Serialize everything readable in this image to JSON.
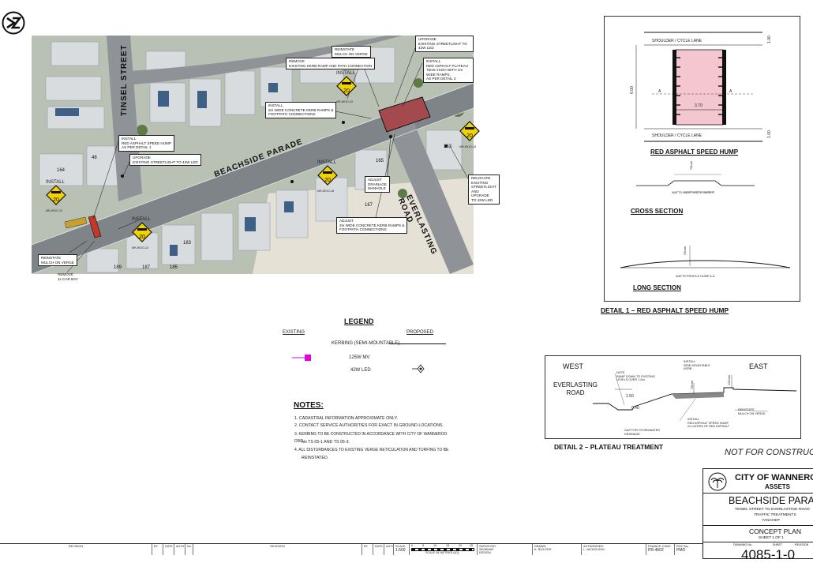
{
  "logo": {
    "icon": "kz-logo-icon"
  },
  "aerial": {
    "streets": {
      "tinsel": "TINSEL STREET",
      "beachside": "BEACHSIDE PARADE",
      "everlasting": "EVERLASTING ROAD"
    },
    "plots": [
      "164",
      "48",
      "163",
      "165",
      "167",
      "183",
      "189",
      "187",
      "185"
    ],
    "callouts": {
      "reinstate_top": "REINSTATE\nMULCH ON VERGE",
      "upgrade_top": "UPGRADE\nEXISTING STREETLIGHT TO 42W LED",
      "install_plateau": "INSTALL\nRED ASPHALT PLATEAU\n75mm HIGH WITH 1m WIDE RAMPS,\nAS PER DETAIL 2",
      "remove_kerb": "REMOVE\nEXISTING KERB RAMP AND PATH CONNECTION",
      "install_ramps_top": "INSTALL\n2m WIDE CONCRETE KERB RAMPS &\nFOOTPATH CONNECTIONS",
      "install_hump": "INSTALL\nRED ASPHALT SPEED HUMP\nAS PER DETAIL 1",
      "upgrade_left": "UPGRADE\nEXISTING STREETLIGHT TO 42W LED",
      "relocate": "RELOCATE\nEXISTING STREETLIGHT AND UPGRADE\nTO 42W LED",
      "adjust_manhole": "ADJUST\nDRAINAGE\nMANHOLE",
      "adjust_ramps": "ADJUST\n2m WIDE CONCRETE KERB RAMPS &\nFOOTPATH CONNECTIONS",
      "reinstate_bottom": "REINSTATE\nMULCH ON VERGE",
      "remove_bay": "REMOVE\n1x CAR BAY"
    },
    "signs": {
      "install": "INSTALL",
      "value": "20",
      "code": "MR-WOO-10",
      "code2": "MR-WOO-18"
    }
  },
  "detail1": {
    "shoulder_top": "SHOULDER / CYCLE LANE",
    "shoulder_bottom": "SHOULDER / CYCLE LANE",
    "width_dim": "6.00",
    "inner_dim": "3.70",
    "edge_dim": "1.00",
    "section_a": "A",
    "title_hump": "RED ASPHALT SPEED HUMP",
    "cross_section": "CROSS SECTION",
    "watts_hump": "WATTS HUMP WIDTH VARIES",
    "height_75": "75mm",
    "watts_profile": "WATTS PROFILE HUMP A-A",
    "long_section": "LONG SECTION",
    "caption": "DETAIL 1 – RED ASPHALT SPEED HUMP"
  },
  "detail2": {
    "west": "WEST",
    "east": "EAST",
    "road": "EVERLASTING\nROAD",
    "note": "NOTE\nRAMP DOWN TO EXISTING\nLEVELS OVER 1.0m.",
    "install_kerb": "INSTALL\nSEMI-MOUNTABLE\nKERB",
    "dim_150": "1.50",
    "dim_040": "0.40",
    "dim_75": "75mm",
    "dim_125": "125mm",
    "reinstate": "REINSTATE\nMULCH ON VERGE",
    "install_hump": "INSTALL\nRED ASPHALT SPEED HUMP\n2x LAYERS OF RED ASPHALT",
    "gap": "GAP FOR STORMWATER\nDRAINAGE",
    "caption": "DETAIL 2 – PLATEAU TREATMENT"
  },
  "legend": {
    "title": "LEGEND",
    "existing": "EXISTING",
    "proposed": "PROPOSED",
    "items": [
      "KERBING (SEMI-MOUNTABLE)",
      "125W MV",
      "42W LED"
    ],
    "colors": {
      "existing_light": "#e600e6"
    }
  },
  "notes": {
    "title": "NOTES:",
    "items": [
      "1.  CADASTRAL INFORMATION APPROXIMATE ONLY.",
      "2.  CONTACT SERVICE AUTHORITIES FOR EXACT IN GROUND LOCATIONS.",
      "3.  KERBING TO BE CONSTRUCTED IN ACCORDANCE WITH CITY OF WANNEROO DRG.",
      "No TS 05-1 AND TS 05-3.",
      "4.  ALL DISTURBANCES TO EXISTING VERGE RETICULATION AND TURFING TO BE",
      "REINSTATED."
    ]
  },
  "stamp": "NOT FOR CONSTRUCTION",
  "title_block": {
    "org": "CITY OF WANNEROO",
    "dept": "ASSETS",
    "project": "BEACHSIDE PARADE",
    "sub1": "TINSEL STREET TO EVERLASTING ROAD",
    "sub2": "TRAFFIC TREATMENTS",
    "sub3": "YANCHEP",
    "plan": "CONCEPT PLAN",
    "sheet": "SHEET 1 OF 1",
    "drawing_no_label": "DRAWING No.",
    "sheet_label": "SHEET",
    "revision_label": "REVISION",
    "drawing_no": "4085-1-0"
  },
  "strip": {
    "revision": "REVISION",
    "by": "BY",
    "date": "DATE",
    "auth": "AUTH",
    "no": "No.",
    "scale_label": "SCALE:",
    "scale": "1:500",
    "scale_ticks": [
      "0",
      "5",
      "10",
      "15",
      "20",
      "25"
    ],
    "scale_caption": "SCALE IN METRES (A1)",
    "surveyed": "SURVEYED:",
    "surveyor": "SEARMAP",
    "designed": "DESIGN",
    "drawn": "DRAWN:",
    "drawer": "K. RICHTER",
    "authorised": "AUTHORISED:",
    "authoriser": "L. NICHOLSON",
    "finance_code": "FINANCE CODE",
    "finance_value": "PR-4502",
    "pmo_label": "PMO No.",
    "pmo_value": "PMO"
  }
}
